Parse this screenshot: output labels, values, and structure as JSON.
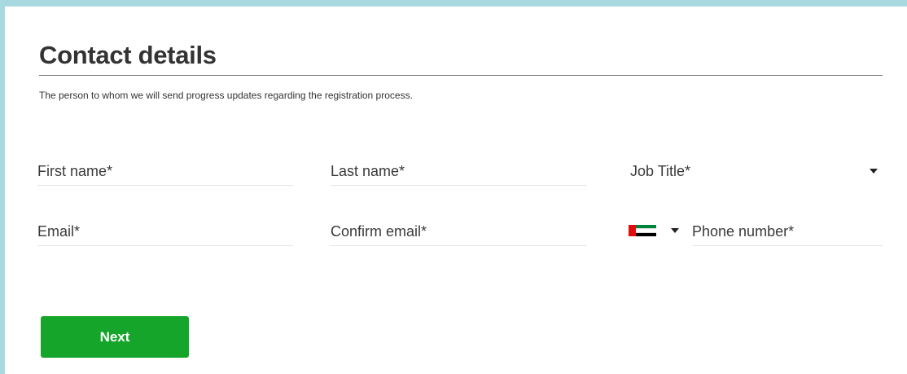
{
  "page": {
    "title": "Contact details",
    "subtitle": "The person to whom we will send progress updates regarding the registration process."
  },
  "form": {
    "first_name": {
      "placeholder": "First name*",
      "value": ""
    },
    "last_name": {
      "placeholder": "Last name*",
      "value": ""
    },
    "job_title": {
      "placeholder": "Job Title*",
      "selected": ""
    },
    "email": {
      "placeholder": "Email*",
      "value": ""
    },
    "confirm_email": {
      "placeholder": "Confirm email*",
      "value": ""
    },
    "phone": {
      "placeholder": "Phone number*",
      "value": "",
      "country_flag": "uae-flag-icon"
    }
  },
  "actions": {
    "next_label": "Next"
  },
  "colors": {
    "frame_border": "#a9d9e0",
    "primary_button": "#15a52a"
  }
}
